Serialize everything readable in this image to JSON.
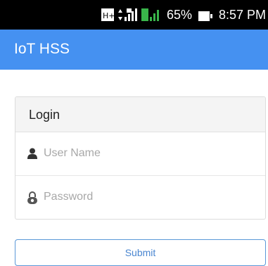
{
  "status_bar": {
    "network_icon": "hplus-icon",
    "signal_icons": [
      "signal-icon",
      "sim-signal-icon"
    ],
    "battery_percent": "65%",
    "battery_icon": "battery-icon",
    "time": "8:57 PM"
  },
  "app_bar": {
    "title": "IoT HSS",
    "color": "#4591f1"
  },
  "login": {
    "title": "Login",
    "username_placeholder": "User Name",
    "username_icon": "user-icon",
    "password_placeholder": "Password",
    "password_icon": "lock-icon"
  },
  "submit": {
    "label": "Submit",
    "color": "#4a86d0"
  }
}
